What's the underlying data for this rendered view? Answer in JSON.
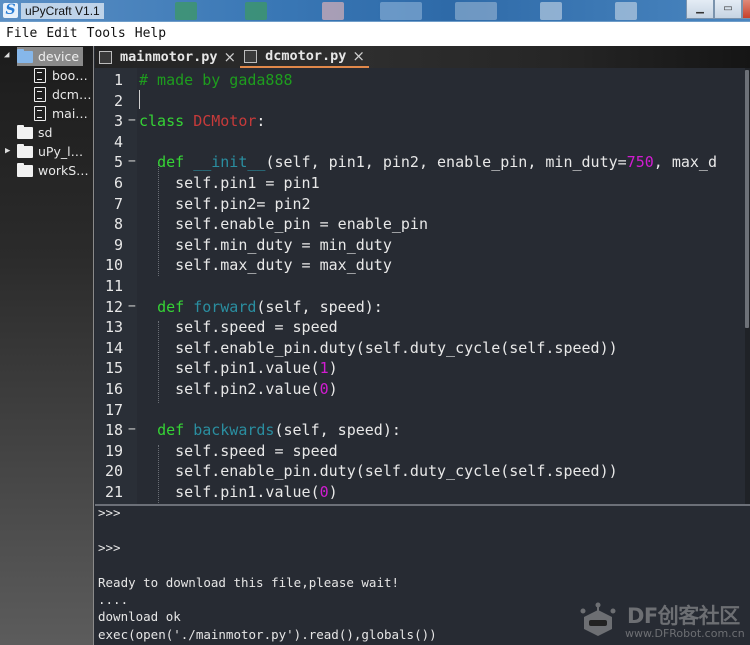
{
  "window": {
    "title": "uPyCraft V1.1",
    "app_icon": "upycraft-logo-icon",
    "controls": [
      "minimize-icon",
      "maximize-icon",
      "close-icon"
    ]
  },
  "menubar": {
    "items": [
      "File",
      "Edit",
      "Tools",
      "Help"
    ]
  },
  "sidebar": {
    "tree": [
      {
        "label": "device",
        "type": "folder",
        "expanded": true,
        "selected": true,
        "icon": "folder-icon"
      },
      {
        "label": "boo…",
        "type": "file",
        "icon": "file-icon"
      },
      {
        "label": "dcm…",
        "type": "file",
        "icon": "file-icon"
      },
      {
        "label": "mai…",
        "type": "file",
        "icon": "file-icon"
      },
      {
        "label": "sd",
        "type": "folder",
        "icon": "folder-icon"
      },
      {
        "label": "uPy_l…",
        "type": "folder",
        "collapsed": true,
        "icon": "folder-icon"
      },
      {
        "label": "workS…",
        "type": "folder",
        "icon": "folder-icon"
      }
    ]
  },
  "tabs": [
    {
      "label": "mainmotor.py",
      "active": false,
      "close": "×"
    },
    {
      "label": "dcmotor.py",
      "active": true,
      "close": "×"
    }
  ],
  "editor": {
    "active_file": "dcmotor.py",
    "lines": [
      {
        "n": "1",
        "fold": "",
        "text": "# made by gada888"
      },
      {
        "n": "2",
        "fold": "",
        "text": ""
      },
      {
        "n": "3",
        "fold": "−",
        "text": "class DCMotor:"
      },
      {
        "n": "4",
        "fold": "",
        "text": ""
      },
      {
        "n": "5",
        "fold": "−",
        "text": "  def __init__(self, pin1, pin2, enable_pin, min_duty=750, max_d"
      },
      {
        "n": "6",
        "fold": "",
        "text": "    self.pin1 = pin1"
      },
      {
        "n": "7",
        "fold": "",
        "text": "    self.pin2= pin2"
      },
      {
        "n": "8",
        "fold": "",
        "text": "    self.enable_pin = enable_pin"
      },
      {
        "n": "9",
        "fold": "",
        "text": "    self.min_duty = min_duty"
      },
      {
        "n": "10",
        "fold": "",
        "text": "    self.max_duty = max_duty"
      },
      {
        "n": "11",
        "fold": "",
        "text": ""
      },
      {
        "n": "12",
        "fold": "−",
        "text": "  def forward(self, speed):"
      },
      {
        "n": "13",
        "fold": "",
        "text": "    self.speed = speed"
      },
      {
        "n": "14",
        "fold": "",
        "text": "    self.enable_pin.duty(self.duty_cycle(self.speed))"
      },
      {
        "n": "15",
        "fold": "",
        "text": "    self.pin1.value(1)"
      },
      {
        "n": "16",
        "fold": "",
        "text": "    self.pin2.value(0)"
      },
      {
        "n": "17",
        "fold": "",
        "text": ""
      },
      {
        "n": "18",
        "fold": "−",
        "text": "  def backwards(self, speed):"
      },
      {
        "n": "19",
        "fold": "",
        "text": "    self.speed = speed"
      },
      {
        "n": "20",
        "fold": "",
        "text": "    self.enable_pin.duty(self.duty_cycle(self.speed))"
      },
      {
        "n": "21",
        "fold": "",
        "text": "    self.pin1.value(0)"
      }
    ],
    "syntax_colors": {
      "comment": "#1e9d1e",
      "keyword": "#35d335",
      "class_name": "#c73a3a",
      "function_name": "#2a8ea0",
      "number": "#d21cd2",
      "text": "#e8e8e8",
      "background": "#272b33"
    }
  },
  "shell": {
    "lines": [
      ">>>",
      "",
      ">>>",
      "",
      "Ready to download this file,please wait!",
      "....",
      "download ok",
      "exec(open('./mainmotor.py').read(),globals())"
    ]
  },
  "watermark": {
    "title": "DF创客社区",
    "url": "www.DFRobot.com.cn"
  },
  "colors": {
    "tab_active_underline": "#e0884a",
    "sidebar_selected": "#8a8a8a",
    "titlebar": "#3a78b6"
  }
}
